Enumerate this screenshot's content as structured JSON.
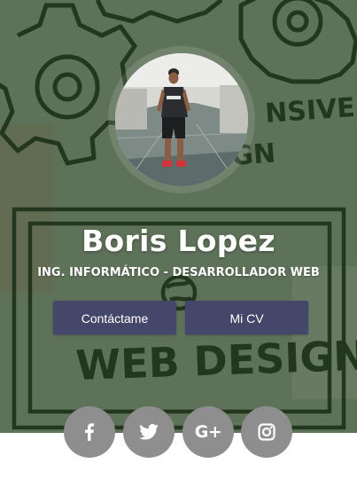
{
  "profile": {
    "name": "Boris Lopez",
    "title": "ING. INFORMÁTICO - DESARROLLADOR WEB"
  },
  "actions": {
    "contact_label": "Contáctame",
    "cv_label": "Mi CV"
  },
  "background": {
    "sketch_words": [
      "NSIVE",
      "GN",
      "WEB DESIGN"
    ]
  },
  "social": {
    "items": [
      {
        "name": "facebook-icon",
        "glyph": "f"
      },
      {
        "name": "twitter-icon",
        "glyph": "twitter-bird"
      },
      {
        "name": "google-plus-icon",
        "glyph": "G+"
      },
      {
        "name": "instagram-icon",
        "glyph": "camera"
      }
    ]
  },
  "colors": {
    "overlay": "#284824",
    "button_bg": "#44466a",
    "social_bg": "#8e8e8e",
    "text": "#ffffff"
  }
}
